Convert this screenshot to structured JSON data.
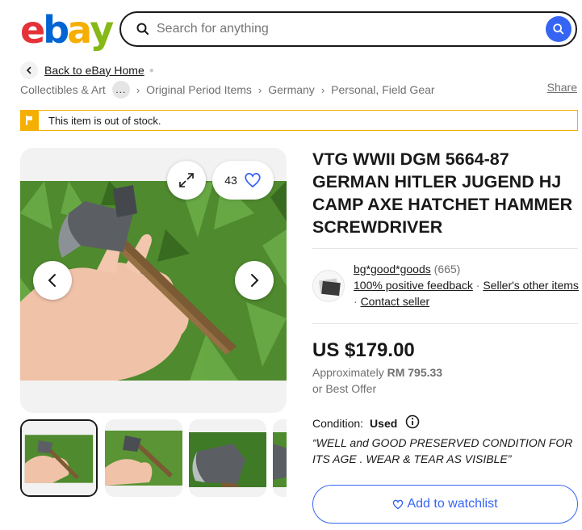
{
  "header": {
    "logo_letters": [
      "e",
      "b",
      "a",
      "y"
    ],
    "logo_colors": [
      "#e53238",
      "#0064d2",
      "#f5af02",
      "#86b817"
    ],
    "search_placeholder": "Search for anything",
    "search_icon": "search-icon"
  },
  "breadcrumbs": {
    "back_label": "Back to eBay Home",
    "items": [
      "Collectibles & Art",
      "Original Period Items",
      "Germany",
      "Personal, Field Gear"
    ],
    "more_label": "...",
    "share_label": "Share"
  },
  "alert": {
    "message": "This item is out of stock.",
    "color": "#f5af02"
  },
  "gallery": {
    "watch_count": "43",
    "thumbnail_count": 4
  },
  "item": {
    "title": "VTG WWII DGM 5664-87 GERMAN HITLER JUGEND HJ CAMP AXE HATCHET HAMMER SCREWDRIVER"
  },
  "seller": {
    "name": "bg*good*goods",
    "feedback_count": "(665)",
    "positive_feedback": "100% positive feedback",
    "other_items": "Seller's other items",
    "contact": "Contact seller"
  },
  "pricing": {
    "price": "US $179.00",
    "approx_prefix": "Approximately",
    "approx_value": "RM 795.33",
    "best_offer": "or Best Offer"
  },
  "condition": {
    "label": "Condition:",
    "value": "Used",
    "quote": "“WELL and GOOD PRESERVED CONDITION FOR ITS AGE . WEAR & TEAR AS VISIBLE”"
  },
  "actions": {
    "watchlist_label": "Add to watchlist",
    "accent": "#3665f3"
  }
}
